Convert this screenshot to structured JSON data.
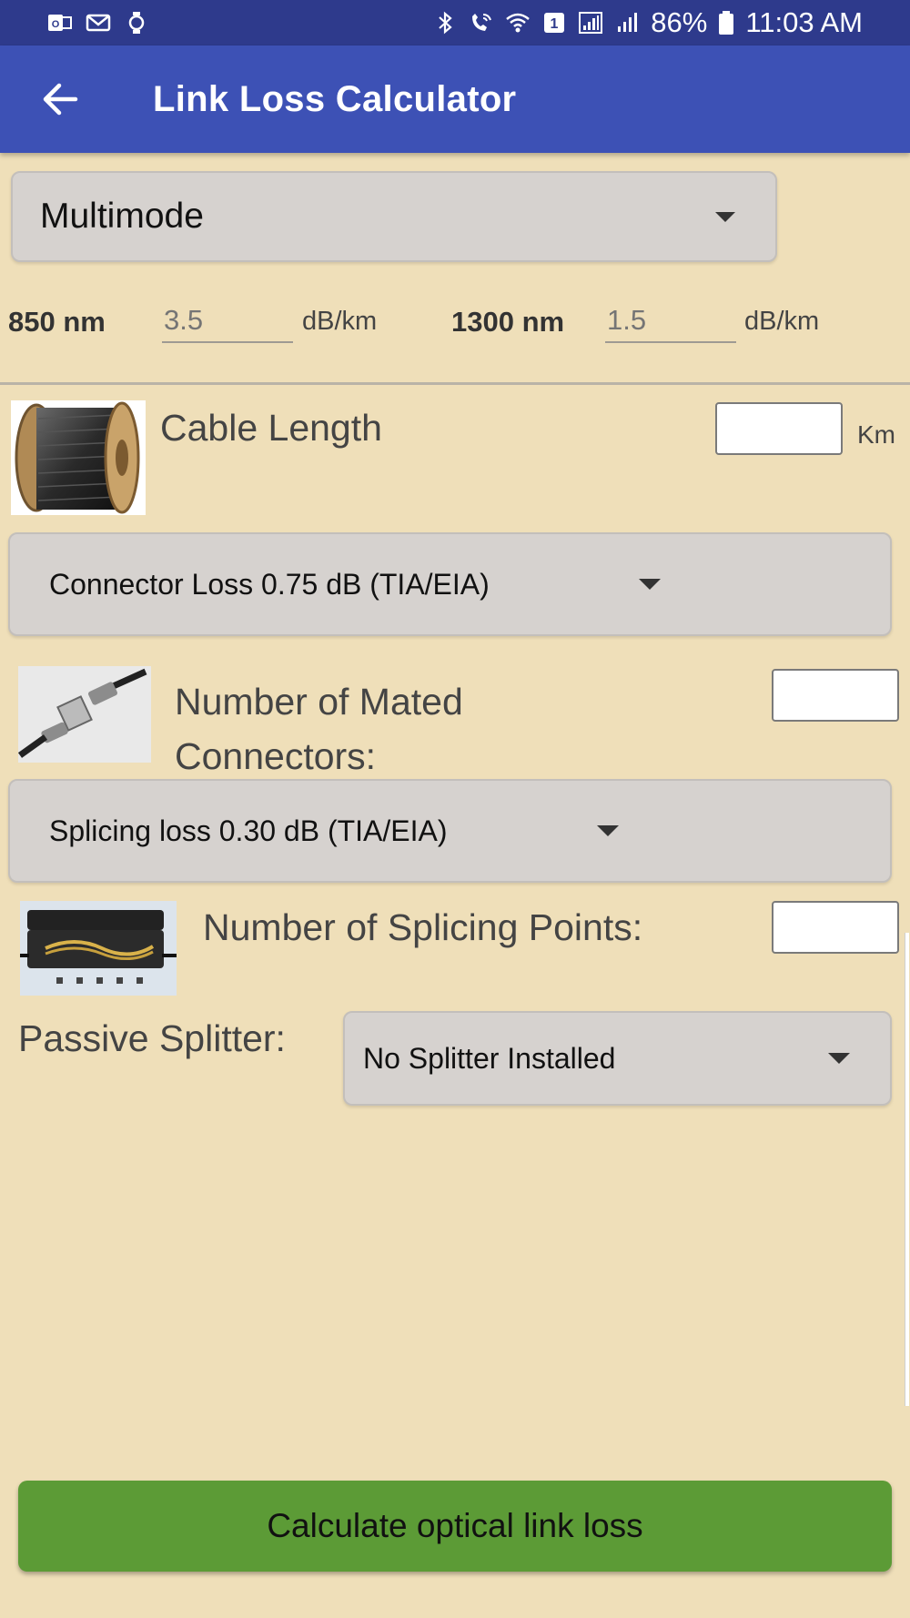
{
  "status_bar": {
    "battery": "86%",
    "time": "11:03 AM",
    "left_icons": [
      "outlook-icon",
      "mail-icon",
      "watch-icon"
    ],
    "right_icons": [
      "bluetooth-icon",
      "wifi-calling-icon",
      "wifi-icon",
      "sim1-icon",
      "signal-icon",
      "signal-2-icon",
      "battery-icon"
    ]
  },
  "app_bar": {
    "title": "Link Loss Calculator"
  },
  "fiber_mode": {
    "selected": "Multimode"
  },
  "attenuation": {
    "wl1_label": "850 nm",
    "wl1_placeholder": "3.5",
    "wl1_unit": "dB/km",
    "wl2_label": "1300 nm",
    "wl2_placeholder": "1.5",
    "wl2_unit": "dB/km"
  },
  "cable": {
    "label": "Cable Length",
    "unit": "Km",
    "value": ""
  },
  "connector_loss": {
    "selected": "Connector Loss 0.75 dB (TIA/EIA)"
  },
  "mated_connectors": {
    "label": "Number of Mated Connectors:",
    "value": ""
  },
  "splicing_loss": {
    "selected": "Splicing loss 0.30 dB (TIA/EIA)"
  },
  "splicing_points": {
    "label": "Number of Splicing Points:",
    "value": ""
  },
  "splitter": {
    "label": "Passive Splitter:",
    "selected": "No Splitter Installed"
  },
  "calculate_button": {
    "label": "Calculate optical link loss"
  },
  "colors": {
    "background": "#efdfb9",
    "app_bar": "#3d51b5",
    "status_bar": "#2e3a8c",
    "button": "#5c9b36"
  }
}
